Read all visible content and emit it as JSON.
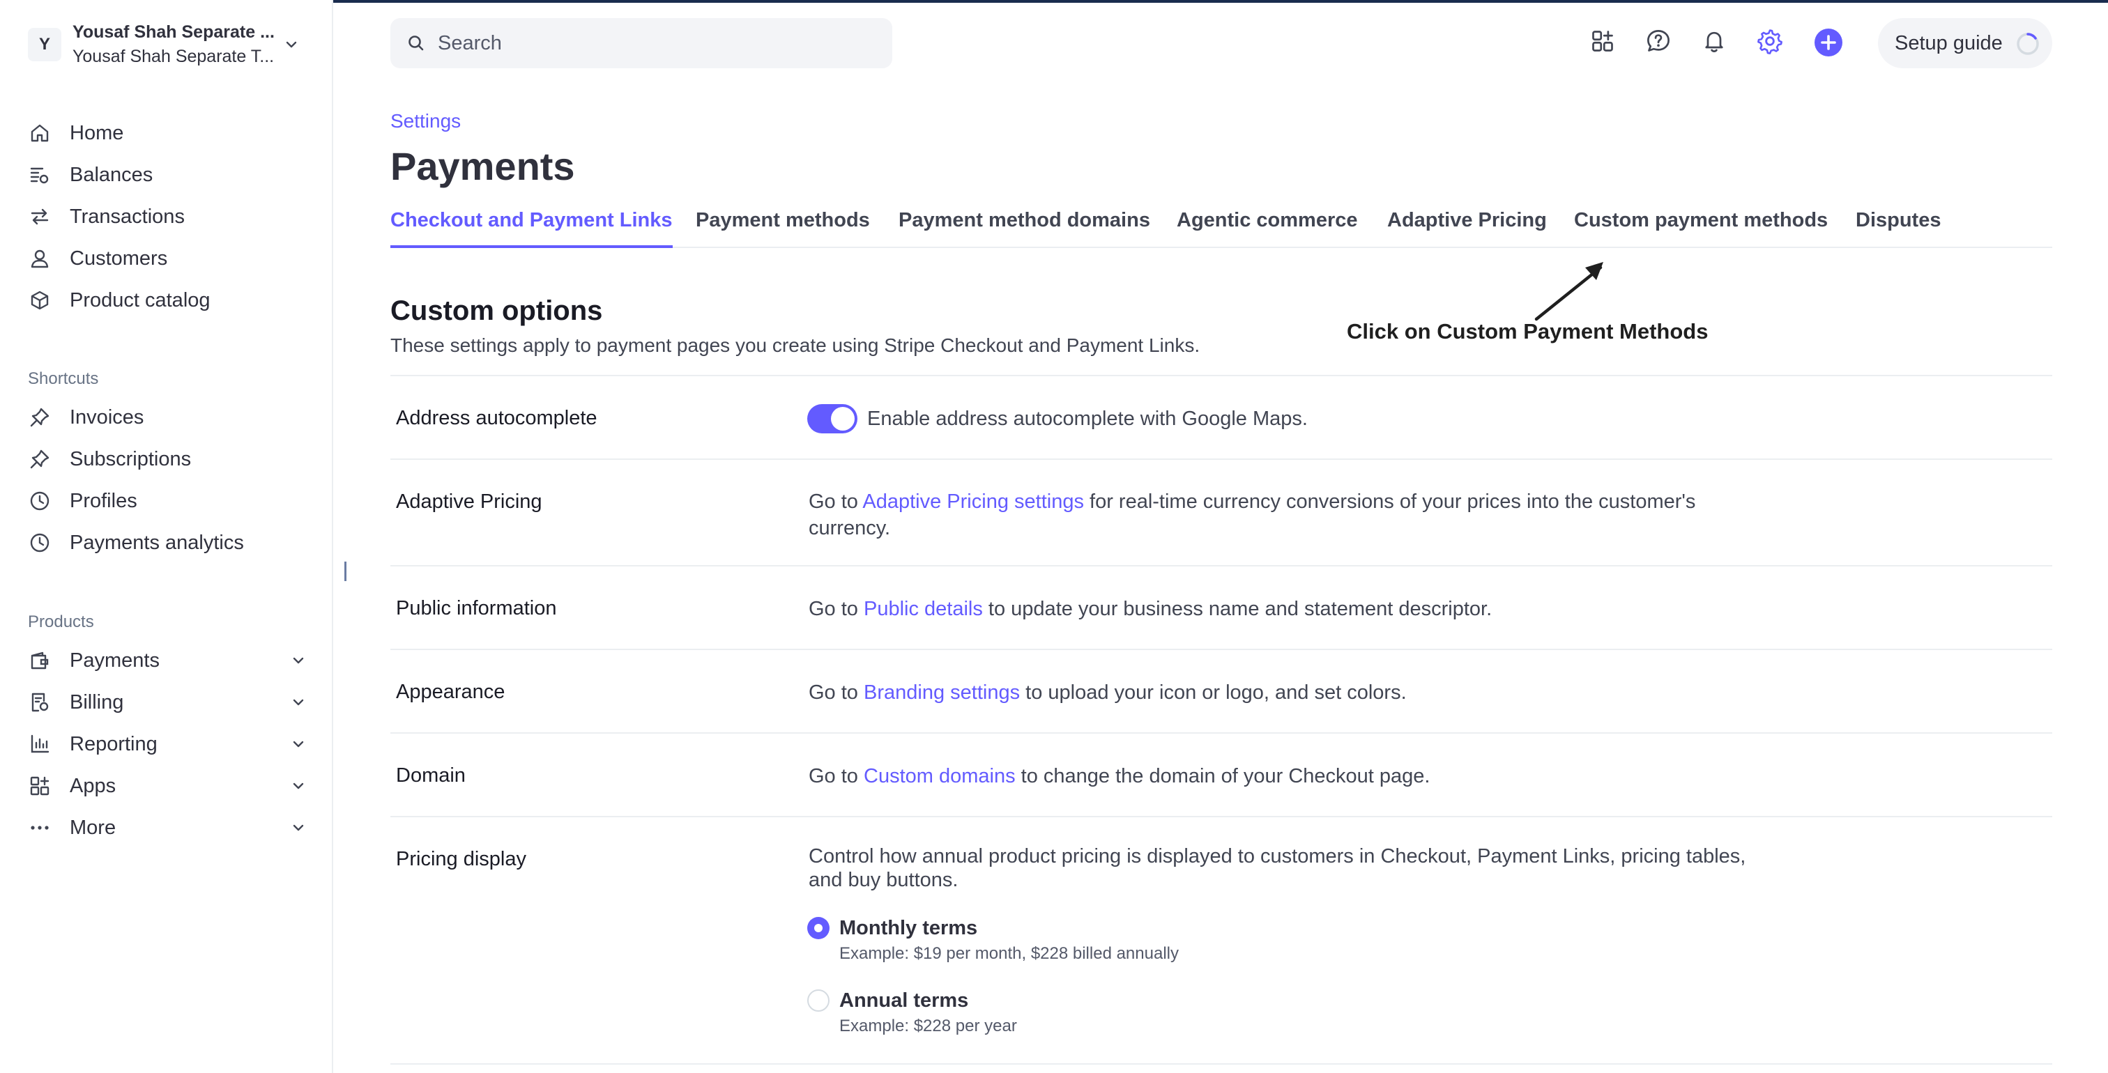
{
  "account": {
    "avatar_letter": "Y",
    "name": "Yousaf Shah Separate ...",
    "subtitle": "Yousaf Shah Separate T..."
  },
  "sidebar": {
    "main_items": [
      {
        "label": "Home",
        "icon": "home-icon"
      },
      {
        "label": "Balances",
        "icon": "balances-icon"
      },
      {
        "label": "Transactions",
        "icon": "transactions-icon"
      },
      {
        "label": "Customers",
        "icon": "customers-icon"
      },
      {
        "label": "Product catalog",
        "icon": "product-catalog-icon"
      }
    ],
    "shortcuts_label": "Shortcuts",
    "shortcuts": [
      {
        "label": "Invoices",
        "icon": "pin-icon"
      },
      {
        "label": "Subscriptions",
        "icon": "pin-icon"
      },
      {
        "label": "Profiles",
        "icon": "clock-icon"
      },
      {
        "label": "Payments analytics",
        "icon": "clock-icon"
      }
    ],
    "products_label": "Products",
    "products": [
      {
        "label": "Payments",
        "icon": "wallet-icon"
      },
      {
        "label": "Billing",
        "icon": "billing-icon"
      },
      {
        "label": "Reporting",
        "icon": "reporting-icon"
      },
      {
        "label": "Apps",
        "icon": "apps-icon"
      },
      {
        "label": "More",
        "icon": "more-icon"
      }
    ]
  },
  "header": {
    "search_placeholder": "Search",
    "setup_guide_label": "Setup guide",
    "icons": [
      "apps-add-icon",
      "help-icon",
      "bell-icon",
      "gear-icon",
      "plus-icon"
    ]
  },
  "page": {
    "breadcrumb": "Settings",
    "title": "Payments",
    "tabs": [
      "Checkout and Payment Links",
      "Payment methods",
      "Payment method domains",
      "Agentic commerce",
      "Adaptive Pricing",
      "Custom payment methods",
      "Disputes"
    ],
    "active_tab": "Checkout and Payment Links"
  },
  "custom_options": {
    "title": "Custom options",
    "description": "These settings apply to payment pages you create using Stripe Checkout and Payment Links."
  },
  "annotation": "Click on Custom Payment Methods",
  "rows": {
    "address": {
      "label": "Address autocomplete",
      "toggle_on": true,
      "text": "Enable address autocomplete with Google Maps."
    },
    "adaptive": {
      "label": "Adaptive Pricing",
      "pre": "Go to ",
      "link": "Adaptive Pricing settings",
      "post": " for real-time currency conversions of your prices into the customer's currency."
    },
    "public": {
      "label": "Public information",
      "pre": "Go to ",
      "link": "Public details",
      "post": " to update your business name and statement descriptor."
    },
    "appearance": {
      "label": "Appearance",
      "pre": "Go to ",
      "link": "Branding settings",
      "post": " to upload your icon or logo, and set colors."
    },
    "domain": {
      "label": "Domain",
      "pre": "Go to ",
      "link": "Custom domains",
      "post": " to change the domain of your Checkout page."
    },
    "pricing": {
      "label": "Pricing display",
      "text": "Control how annual product pricing is displayed to customers in Checkout, Payment Links, pricing tables, and buy buttons.",
      "options": [
        {
          "title": "Monthly terms",
          "example": "Example: $19 per month, $228 billed annually",
          "selected": true
        },
        {
          "title": "Annual terms",
          "example": "Example: $228 per year",
          "selected": false
        }
      ]
    }
  },
  "colors": {
    "accent": "#635bff",
    "text": "#30313d",
    "muted": "#687385"
  }
}
